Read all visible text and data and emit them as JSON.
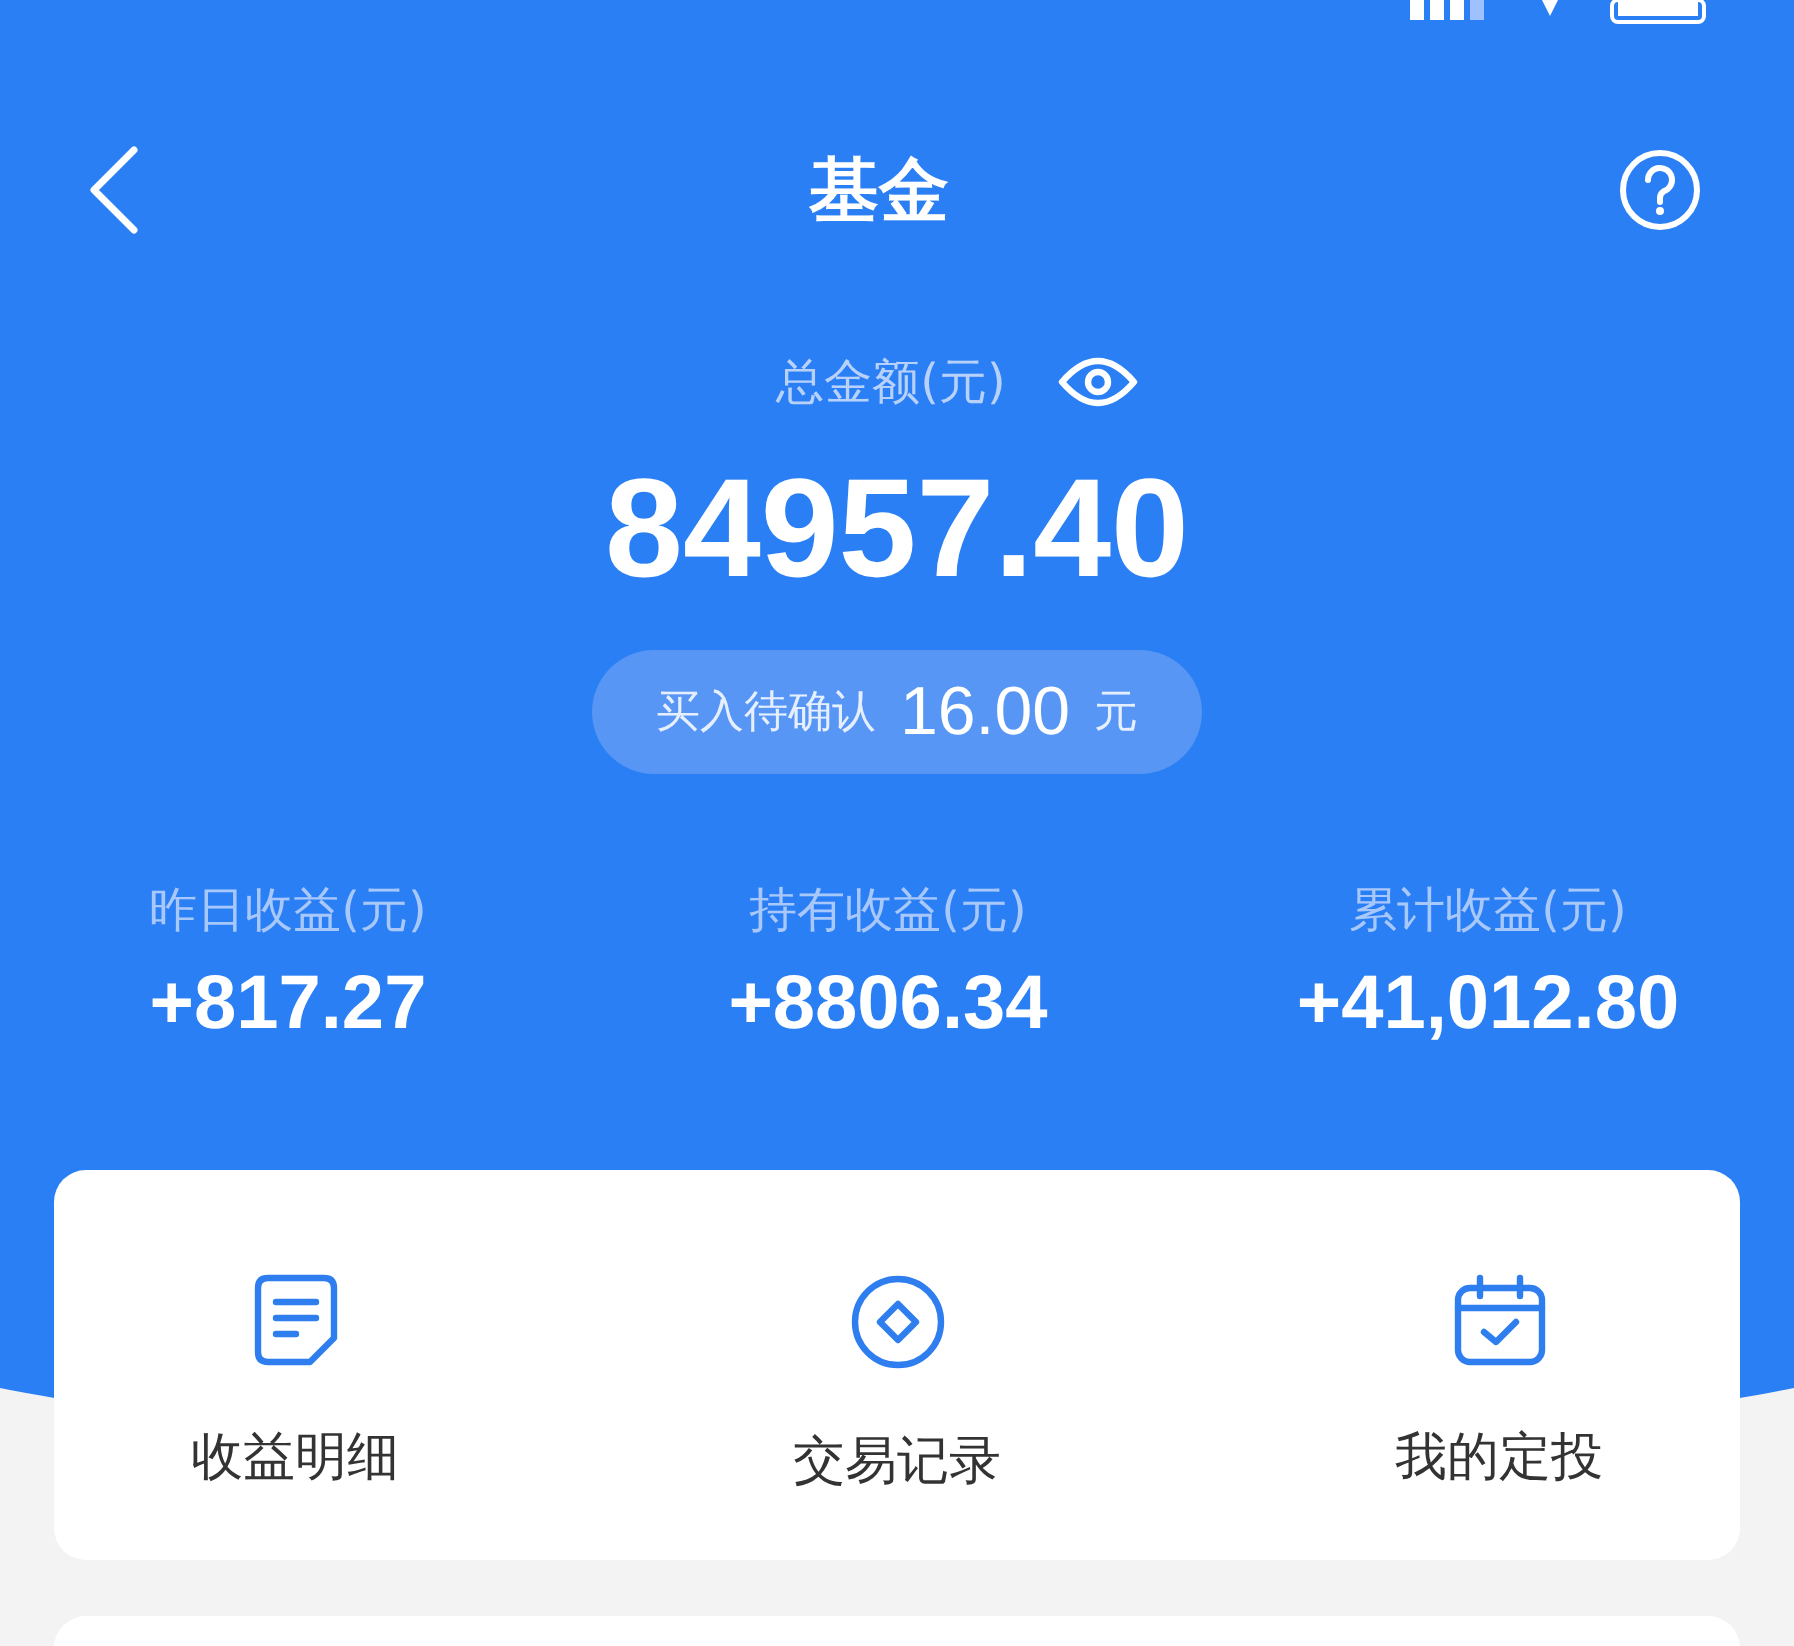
{
  "nav": {
    "title": "基金"
  },
  "total": {
    "label": "总金额(元)",
    "amount": "84957.40",
    "pending_label": "买入待确认",
    "pending_amount": "16.00",
    "pending_unit": "元"
  },
  "stats": [
    {
      "label": "昨日收益(元)",
      "value": "+817.27"
    },
    {
      "label": "持有收益(元)",
      "value": "+8806.34"
    },
    {
      "label": "累计收益(元)",
      "value": "+41,012.80"
    }
  ],
  "actions": [
    {
      "kind": "document",
      "label": "收益明细"
    },
    {
      "kind": "diamond",
      "label": "交易记录"
    },
    {
      "kind": "calendar",
      "label": "我的定投"
    }
  ]
}
